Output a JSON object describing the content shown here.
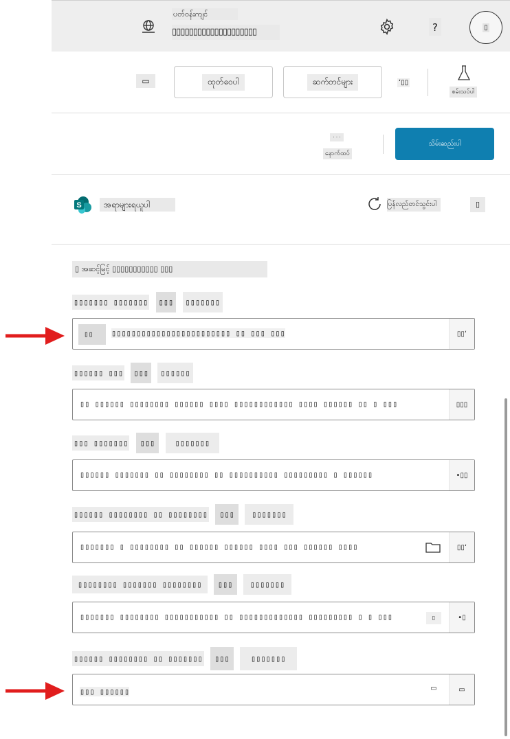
{
  "header": {
    "env_label": "ပတ်ဝန်းကျင်",
    "env_name": "▯▯▯▯▯▯▯▯▯▯▯▯▯▯▯▯▯▯▯▯",
    "avatar": "▯"
  },
  "toolbar": {
    "open_label": "ထုတ်ဝေပါ",
    "settings_label": "ဆက်တင်များ",
    "small_label": "ʻ▯▯",
    "lab_label": "စမ်းသပ်ပါ",
    "back_icon_label": "▭"
  },
  "actionbar": {
    "secondary_top": "· · ·",
    "secondary_label": "နောက်ထပ်",
    "primary_label": "သိမ်းဆည်းပါ"
  },
  "source": {
    "title": "အရာများရယူပါ",
    "refresh_label": "ပြန်လည်တင်သွင်းပါ",
    "more_label": "▯"
  },
  "section": {
    "heading": "▯ အဆင့်မြင့် ▯▯▯▯▯▯▯▯▯▯▯ ▯▯▯"
  },
  "fields": [
    {
      "label": "▯▯▯▯▯▯▯ ▯▯▯▯▯▯▯",
      "tag": "▯▯▯",
      "tag2": "▯▯▯▯▯▯▯",
      "prefix": "▯▯",
      "value": "▯▯▯▯▯▯▯▯▯▯▯▯▯▯▯▯▯▯▯▯▯▯▯▯ ▯▯ ▯▯▯ ▯▯▯",
      "end": "▯▯ʻ"
    },
    {
      "label": "▯▯▯▯▯▯ ▯▯▯",
      "tag": "▯▯▯",
      "tag2": "▯▯▯▯▯▯",
      "value": "▯▯ ▯▯▯▯▯▯ ▯▯▯▯▯▯▯▯ ▯▯▯▯▯▯ ▯▯▯▯ ▯▯▯▯▯▯▯▯▯▯▯▯ ▯▯▯▯ ▯▯▯▯▯▯ ▯▯ ▯ ▯▯▯",
      "end": "▯▯▯"
    },
    {
      "label": "▯▯▯ ▯▯▯▯▯▯▯",
      "tag": "▯▯▯",
      "tag2": "▯▯▯▯▯▯▯",
      "value": "▯▯▯▯▯▯ ▯▯▯▯▯▯▯ ▯▯ ▯▯▯▯▯▯▯▯ ▯▯ ▯▯▯▯▯▯▯▯▯▯ ▯▯▯▯▯▯▯▯▯ ▯ ▯▯▯▯▯▯",
      "end": "•▯▯"
    },
    {
      "label": "▯▯▯▯▯▯ ▯▯▯▯▯▯▯▯ ▯▯ ▯▯▯▯▯▯▯▯",
      "tag": "▯▯▯",
      "tag2": "▯▯▯▯▯▯▯",
      "value": "▯▯▯▯▯▯▯ ▯ ▯▯▯▯▯▯▯▯ ▯▯ ▯▯▯▯▯▯ ▯▯▯▯▯▯ ▯▯▯▯ ▯▯▯ ▯▯▯▯▯▯ ▯▯▯▯",
      "end": "▯▯ʻ"
    },
    {
      "label": "▯▯▯▯▯▯▯▯ ▯▯▯▯▯▯▯ ▯▯▯▯▯▯▯▯",
      "tag": "▯▯▯",
      "tag2": "▯▯▯▯▯▯▯",
      "value": "▯▯▯▯▯▯▯ ▯▯▯▯▯▯▯▯ ▯▯▯▯▯▯▯▯▯▯▯ ▯▯ ▯▯▯▯▯▯▯▯▯▯▯▯▯ ▯▯▯▯▯▯▯▯▯ ▯ ▯ ▯▯▯",
      "end": "•▯"
    },
    {
      "label": "▯▯▯▯▯▯ ▯▯▯▯▯▯▯▯ ▯▯ ▯▯▯▯▯▯▯",
      "tag": "▯▯▯",
      "tag2": "▯▯▯▯▯▯▯",
      "value": "▯▯▯ ▯▯▯▯▯▯",
      "end": "▭"
    }
  ],
  "colors": {
    "primary": "#0f7fb0",
    "arrow": "#e11d1d",
    "sharepoint": "#038387"
  }
}
